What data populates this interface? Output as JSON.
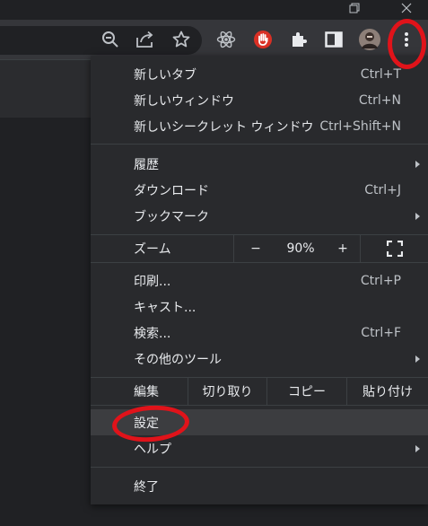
{
  "menu": {
    "items": [
      {
        "label": "新しいタブ",
        "shortcut": "Ctrl+T"
      },
      {
        "label": "新しいウィンドウ",
        "shortcut": "Ctrl+N"
      },
      {
        "label": "新しいシークレット ウィンドウ",
        "shortcut": "Ctrl+Shift+N"
      },
      {
        "label": "履歴",
        "shortcut": ""
      },
      {
        "label": "ダウンロード",
        "shortcut": "Ctrl+J"
      },
      {
        "label": "ブックマーク",
        "shortcut": ""
      },
      {
        "label": "印刷...",
        "shortcut": "Ctrl+P"
      },
      {
        "label": "キャスト...",
        "shortcut": ""
      },
      {
        "label": "検索...",
        "shortcut": "Ctrl+F"
      },
      {
        "label": "その他のツール",
        "shortcut": ""
      },
      {
        "label": "設定",
        "shortcut": ""
      },
      {
        "label": "ヘルプ",
        "shortcut": ""
      },
      {
        "label": "終了",
        "shortcut": ""
      }
    ],
    "zoom": {
      "label": "ズーム",
      "minus": "−",
      "value": "90%",
      "plus": "+"
    },
    "edit": {
      "label": "編集",
      "cut": "切り取り",
      "copy": "コピー",
      "paste": "貼り付け"
    }
  },
  "toolbar": {
    "icons": [
      "zoom-out-icon",
      "share-icon",
      "bookmark-star-icon",
      "react-devtools-icon",
      "stop-hand-extension-icon",
      "extensions-puzzle-icon",
      "side-panel-icon",
      "profile-avatar",
      "more-menu-icon"
    ]
  },
  "colors": {
    "annotation_red": "#e0131a",
    "menu_bg": "#292a2d",
    "toolbar_bg": "#35363a"
  }
}
